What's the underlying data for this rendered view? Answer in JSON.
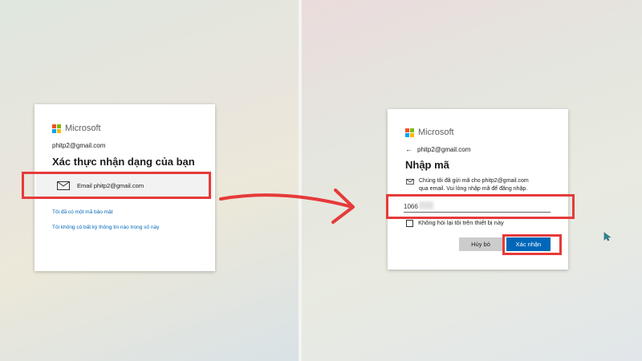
{
  "left_card": {
    "brand": "Microsoft",
    "account": "phitp2@gmail.com",
    "title": "Xác thực nhận dạng của bạn",
    "email_option": "Email phitp2@gmail.com",
    "link_have_code": "Tôi đã có một mã bảo mật",
    "link_no_info": "Tôi không có bất kỳ thông tin nào trong số này"
  },
  "right_card": {
    "brand": "Microsoft",
    "account": "phitp2@gmail.com",
    "title": "Nhập mã",
    "message_line1": "Chúng tôi đã gửi mã cho phitp2@gmail.com",
    "message_line2": "qua email. Vui lòng nhập mã để đăng nhập.",
    "code_value": "1066",
    "checkbox_label": "Không hỏi lại tôi trên thiết bị này",
    "cancel_label": "Hủy bỏ",
    "confirm_label": "Xác nhận"
  },
  "colors": {
    "highlight": "#e63a3a",
    "primary": "#0067b8",
    "link": "#0067b8"
  },
  "icons": {
    "logo": "microsoft-logo",
    "email": "envelope-icon",
    "back": "back-arrow-icon",
    "pointer": "mouse-cursor-icon",
    "flow": "curved-arrow"
  }
}
